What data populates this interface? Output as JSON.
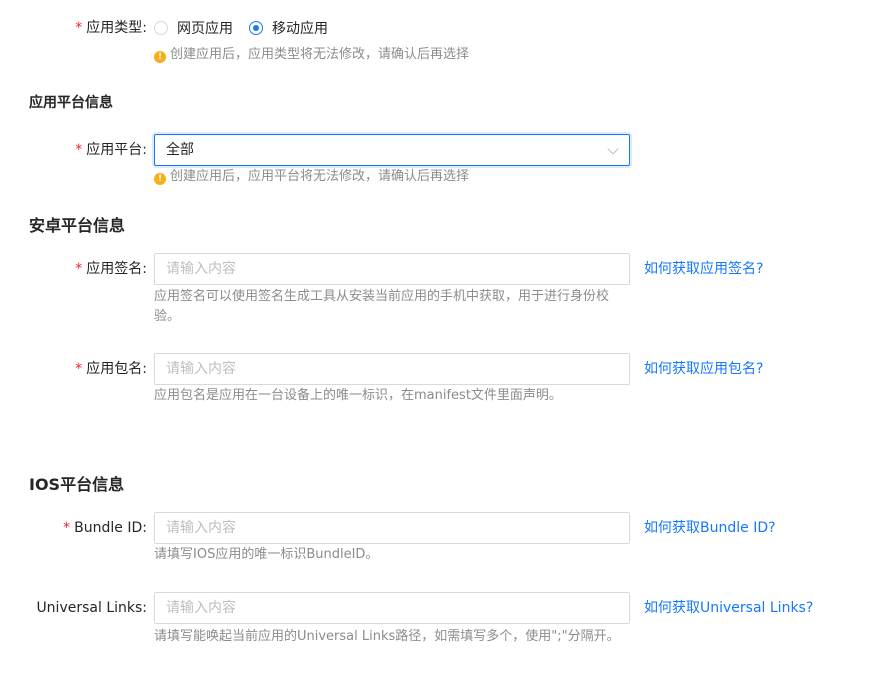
{
  "app_type": {
    "label": "应用类型",
    "options": [
      "网页应用",
      "移动应用"
    ],
    "selected": "移动应用",
    "hint": "创建应用后，应用类型将无法修改，请确认后再选择"
  },
  "platform_section": {
    "title": "应用平台信息",
    "platform_label": "应用平台",
    "platform_value": "全部",
    "hint": "创建应用后，应用平台将无法修改，请确认后再选择"
  },
  "android_section": {
    "title": "安卓平台信息",
    "signature": {
      "label": "应用签名",
      "placeholder": "请输入内容",
      "link": "如何获取应用签名?",
      "hint": "应用签名可以使用签名生成工具从安装当前应用的手机中获取，用于进行身份校验。"
    },
    "package": {
      "label": "应用包名",
      "placeholder": "请输入内容",
      "link": "如何获取应用包名?",
      "hint": "应用包名是应用在一台设备上的唯一标识，在manifest文件里面声明。"
    }
  },
  "ios_section": {
    "title": "IOS平台信息",
    "bundle": {
      "label": "Bundle ID",
      "placeholder": "请输入内容",
      "link": "如何获取Bundle ID?",
      "hint": "请填写IOS应用的唯一标识BundleID。"
    },
    "universal": {
      "label": "Universal Links",
      "placeholder": "请输入内容",
      "link": "如何获取Universal Links?",
      "hint": "请填写能唤起当前应用的Universal Links路径，如需填写多个，使用\";\"分隔开。"
    }
  },
  "colors": {
    "primary": "#1677ff",
    "required": "#f5222d",
    "warning": "#faad14"
  }
}
